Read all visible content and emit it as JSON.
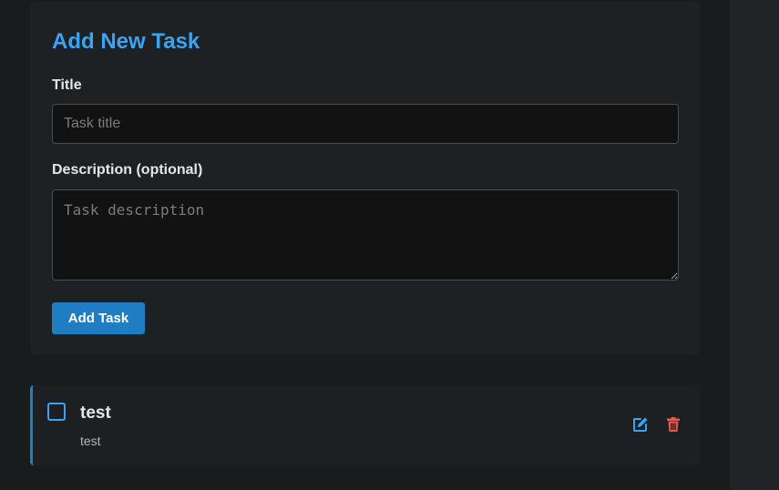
{
  "form": {
    "heading": "Add New Task",
    "title_label": "Title",
    "title_placeholder": "Task title",
    "title_value": "",
    "description_label": "Description (optional)",
    "description_placeholder": "Task description",
    "description_value": "",
    "submit_label": "Add Task"
  },
  "tasks": [
    {
      "title": "test",
      "description": "test",
      "completed": false,
      "edit_icon": "edit-icon",
      "delete_icon": "trash-icon"
    }
  ],
  "colors": {
    "accent": "#3ba3f0",
    "button": "#1f7dc4",
    "danger": "#f0534a",
    "background": "#191c1d",
    "card": "#1e2123"
  }
}
